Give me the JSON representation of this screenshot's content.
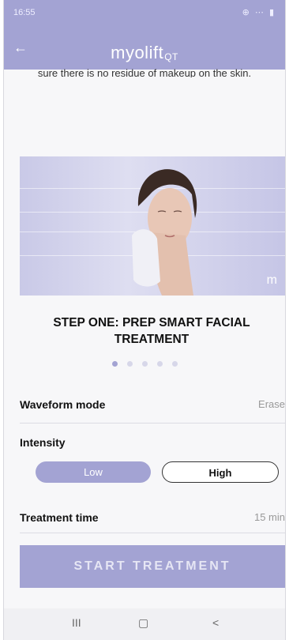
{
  "status": {
    "time": "16:55",
    "icons": "⊕ ⋯ ▮"
  },
  "header": {
    "brand_main": "myolift",
    "brand_sub": "QT",
    "back_icon": "arrow-left-icon"
  },
  "intro_text": "sure there is no residue of makeup on the skin.",
  "hero": {
    "watermark": "m"
  },
  "step": {
    "title_line1": "STEP ONE: PREP SMART FACIAL",
    "title_line2": "TREATMENT",
    "active_index": 0,
    "total": 5
  },
  "settings": {
    "waveform": {
      "label": "Waveform mode",
      "value": "Erase"
    },
    "intensity": {
      "label": "Intensity",
      "low": "Low",
      "high": "High",
      "selected": "Low"
    },
    "time": {
      "label": "Treatment time",
      "value": "15 min"
    }
  },
  "cta": {
    "label": "START TREATMENT"
  },
  "navbar": {
    "recents": "III",
    "home": "▢",
    "back": "<"
  },
  "colors": {
    "accent": "#a3a3d3"
  }
}
